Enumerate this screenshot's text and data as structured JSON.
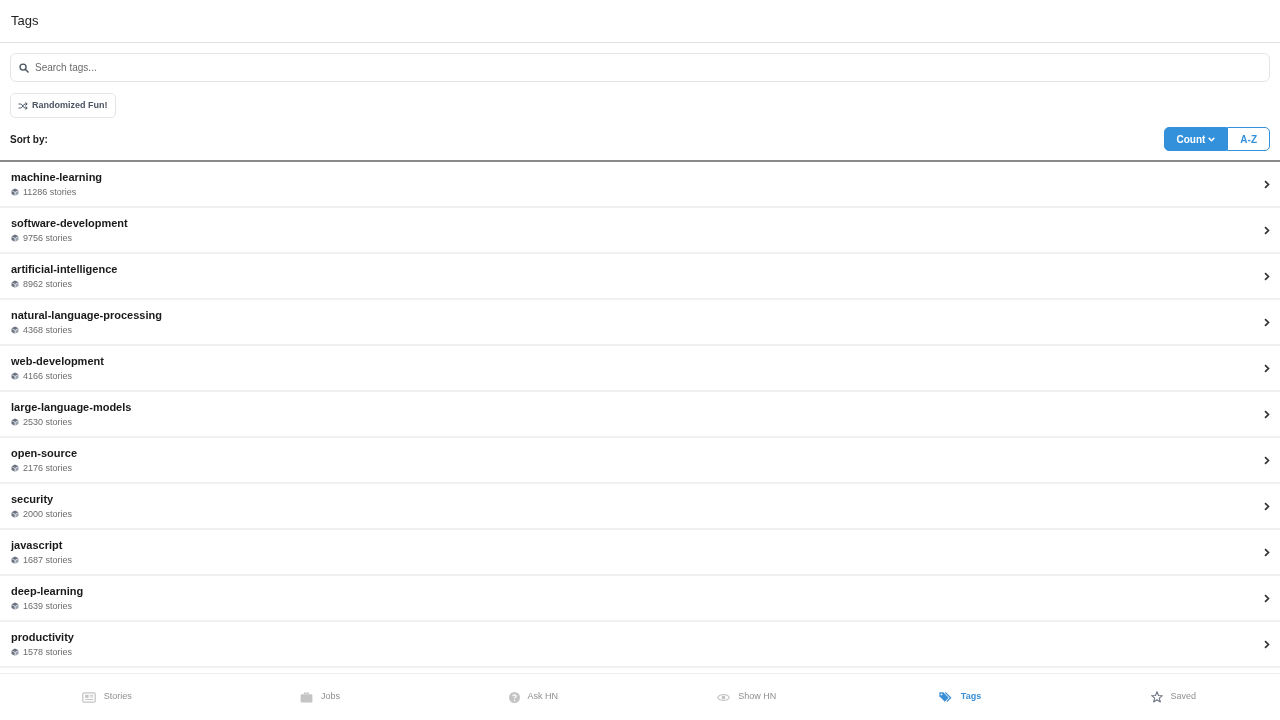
{
  "header": {
    "title": "Tags"
  },
  "search": {
    "placeholder": "Search tags..."
  },
  "random_button": {
    "label": "Randomized Fun!"
  },
  "sort": {
    "label": "Sort by:",
    "options": [
      {
        "label": "Count",
        "selected": true
      },
      {
        "label": "A-Z",
        "selected": false
      }
    ]
  },
  "tags": [
    {
      "name": "machine-learning",
      "count": "11286 stories"
    },
    {
      "name": "software-development",
      "count": "9756 stories"
    },
    {
      "name": "artificial-intelligence",
      "count": "8962 stories"
    },
    {
      "name": "natural-language-processing",
      "count": "4368 stories"
    },
    {
      "name": "web-development",
      "count": "4166 stories"
    },
    {
      "name": "large-language-models",
      "count": "2530 stories"
    },
    {
      "name": "open-source",
      "count": "2176 stories"
    },
    {
      "name": "security",
      "count": "2000 stories"
    },
    {
      "name": "javascript",
      "count": "1687 stories"
    },
    {
      "name": "deep-learning",
      "count": "1639 stories"
    },
    {
      "name": "productivity",
      "count": "1578 stories"
    }
  ],
  "tab_bar": [
    {
      "label": "Stories",
      "selected": false
    },
    {
      "label": "Jobs",
      "selected": false
    },
    {
      "label": "Ask HN",
      "selected": false
    },
    {
      "label": "Show HN",
      "selected": false
    },
    {
      "label": "Tags",
      "selected": true
    },
    {
      "label": "Saved",
      "selected": false
    }
  ]
}
